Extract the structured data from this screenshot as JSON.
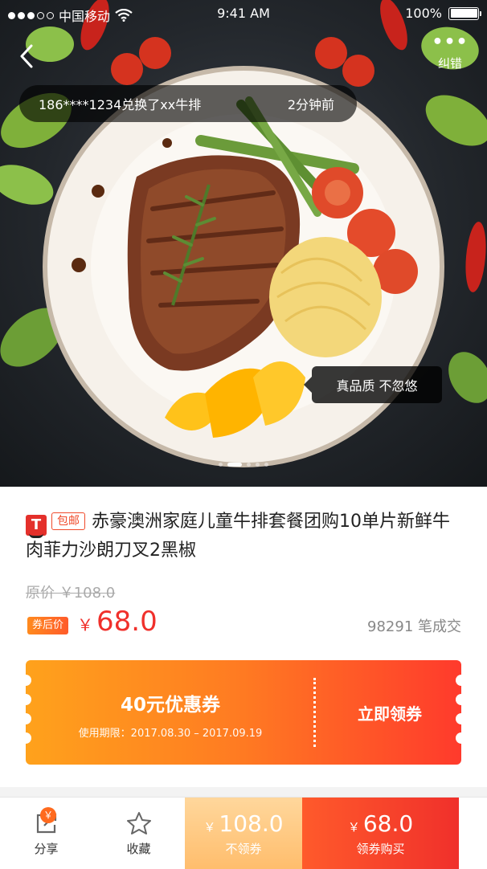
{
  "status_bar": {
    "carrier": "中国移动",
    "time": "9:41 AM",
    "battery": "100%"
  },
  "nav": {
    "report_label": "纠错"
  },
  "ticker": {
    "message": "186****1234兑换了xx牛排",
    "when": "2分钟前"
  },
  "hero": {
    "tooltip": "真品质 不忽悠",
    "slides_total": 5,
    "active_slide": 2
  },
  "product": {
    "platform_badge": "T",
    "shipping_tag": "包邮",
    "title": "赤豪澳洲家庭儿童牛排套餐团购10单片新鲜牛肉菲力沙朗刀叉2黑椒",
    "original_price_label": "原价 ￥108.0",
    "coupon_price_tag": "券后价",
    "currency": "￥",
    "price": "68.0",
    "sold": "98291 笔成交"
  },
  "coupon": {
    "name": "40元优惠券",
    "validity": "使用期限：2017.08.30 – 2017.09.19",
    "claim_label": "立即领券"
  },
  "bottom_bar": {
    "share_label": "分享",
    "share_badge": "￥",
    "favorite_label": "收藏",
    "no_coupon_price": "108.0",
    "no_coupon_label": "不领券",
    "coupon_price": "68.0",
    "coupon_buy_label": "领券购买",
    "currency": "￥"
  },
  "colors": {
    "accent": "#f0302b",
    "coupon_start": "#ffa21c",
    "coupon_end": "#ff3a2c"
  }
}
